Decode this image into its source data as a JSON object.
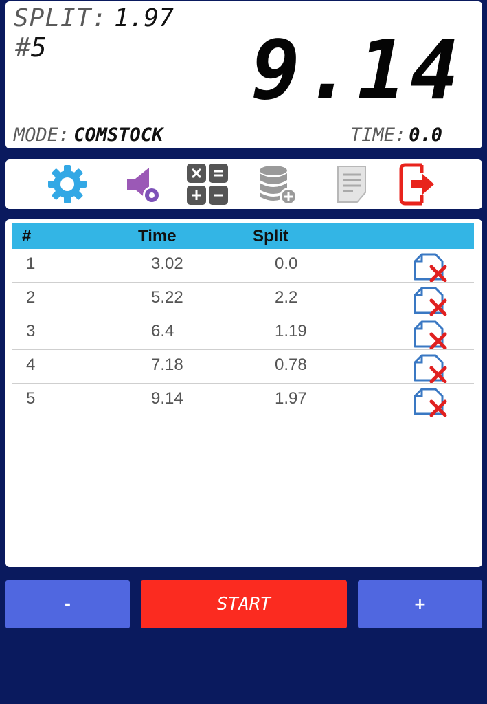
{
  "display": {
    "split_label": "SPLIT:",
    "split_value": "1.97",
    "count_hash": "#",
    "count_value": "5",
    "big_time": "9.14",
    "mode_label": "MODE:",
    "mode_value": "COMSTOCK",
    "time_label": "TIME:",
    "time_value": "0.0"
  },
  "toolbar": {
    "icons": [
      "gear-icon",
      "sound-settings-icon",
      "calculator-icon",
      "database-add-icon",
      "notes-icon",
      "exit-icon"
    ],
    "colors": {
      "gear": "#33a8e5",
      "sound": "#9b59b6",
      "calculator": "#555555",
      "database": "#9a9a9a",
      "exit": "#e8231c"
    }
  },
  "table": {
    "headers": {
      "num": "#",
      "time": "Time",
      "split": "Split"
    },
    "rows": [
      {
        "num": "1",
        "time": "3.02",
        "split": "0.0"
      },
      {
        "num": "2",
        "time": "5.22",
        "split": "2.2"
      },
      {
        "num": "3",
        "time": "6.4",
        "split": "1.19"
      },
      {
        "num": "4",
        "time": "7.18",
        "split": "0.78"
      },
      {
        "num": "5",
        "time": "9.14",
        "split": "1.97"
      }
    ]
  },
  "buttons": {
    "minus": "-",
    "start": "START",
    "plus": "+"
  },
  "colors": {
    "background": "#0a1a5e",
    "header": "#33b5e5",
    "start": "#fb2b20",
    "step": "#5067e0"
  }
}
